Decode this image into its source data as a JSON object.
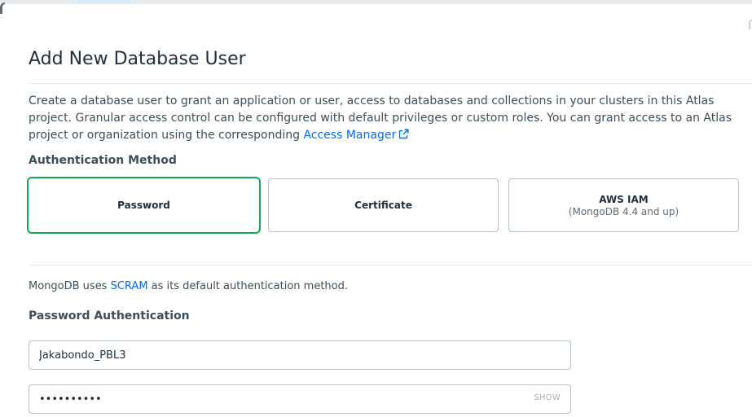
{
  "modal": {
    "title": "Add New Database User",
    "description_pre": "Create a database user to grant an application or user, access to databases and collections in your clusters in this Atlas project. Granular access control can be configured with default privileges or custom roles. You can grant access to an Atlas project or organization using the corresponding ",
    "access_manager_link": "Access Manager",
    "external_link_icon": "external-link-icon"
  },
  "auth_method": {
    "label": "Authentication Method",
    "options": [
      {
        "label": "Password",
        "sublabel": "",
        "selected": true
      },
      {
        "label": "Certificate",
        "sublabel": "",
        "selected": false
      },
      {
        "label": "AWS IAM",
        "sublabel": "(MongoDB 4.4 and up)",
        "selected": false
      }
    ]
  },
  "scram": {
    "prefix": "MongoDB uses ",
    "link": "SCRAM",
    "suffix": " as its default authentication method."
  },
  "password_auth": {
    "label": "Password Authentication",
    "username_value": "Jakabondo_PBL3",
    "password_value": "••••••••••",
    "show_label": "SHOW"
  },
  "colors": {
    "selected_border": "#13aa52",
    "link": "#016bf8"
  }
}
